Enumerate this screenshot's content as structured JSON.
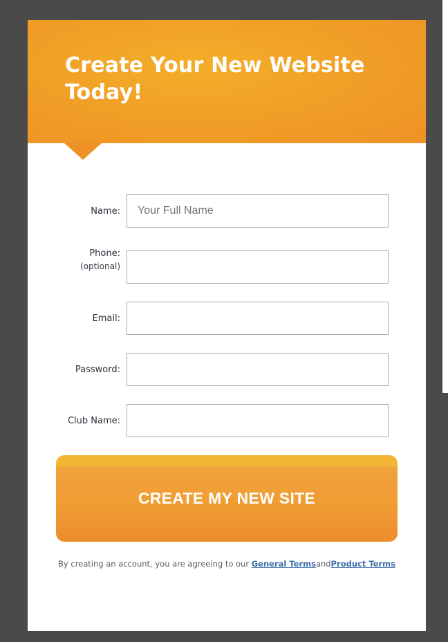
{
  "banner": {
    "title": "Create Your New Website Today!"
  },
  "form": {
    "fields": [
      {
        "label": "Name:",
        "sublabel": "",
        "value": "",
        "placeholder": "Your Full Name",
        "type": "text"
      },
      {
        "label": "Phone:",
        "sublabel": "(optional)",
        "value": "",
        "placeholder": "",
        "type": "tel"
      },
      {
        "label": "Email:",
        "sublabel": "",
        "value": "",
        "placeholder": "",
        "type": "email"
      },
      {
        "label": "Password:",
        "sublabel": "",
        "value": "",
        "placeholder": "",
        "type": "password"
      },
      {
        "label": "Club Name:",
        "sublabel": "",
        "value": "",
        "placeholder": "",
        "type": "text"
      }
    ],
    "submit_label": "CREATE MY NEW SITE"
  },
  "legal": {
    "prefix": "By creating an account, you are agreeing to our",
    "general_terms": "General Terms",
    "connector": "and",
    "product_terms": "Product Terms"
  },
  "colors": {
    "frame": "#4a4a4a",
    "accent": "#f1a027",
    "link": "#3f6ea8"
  }
}
